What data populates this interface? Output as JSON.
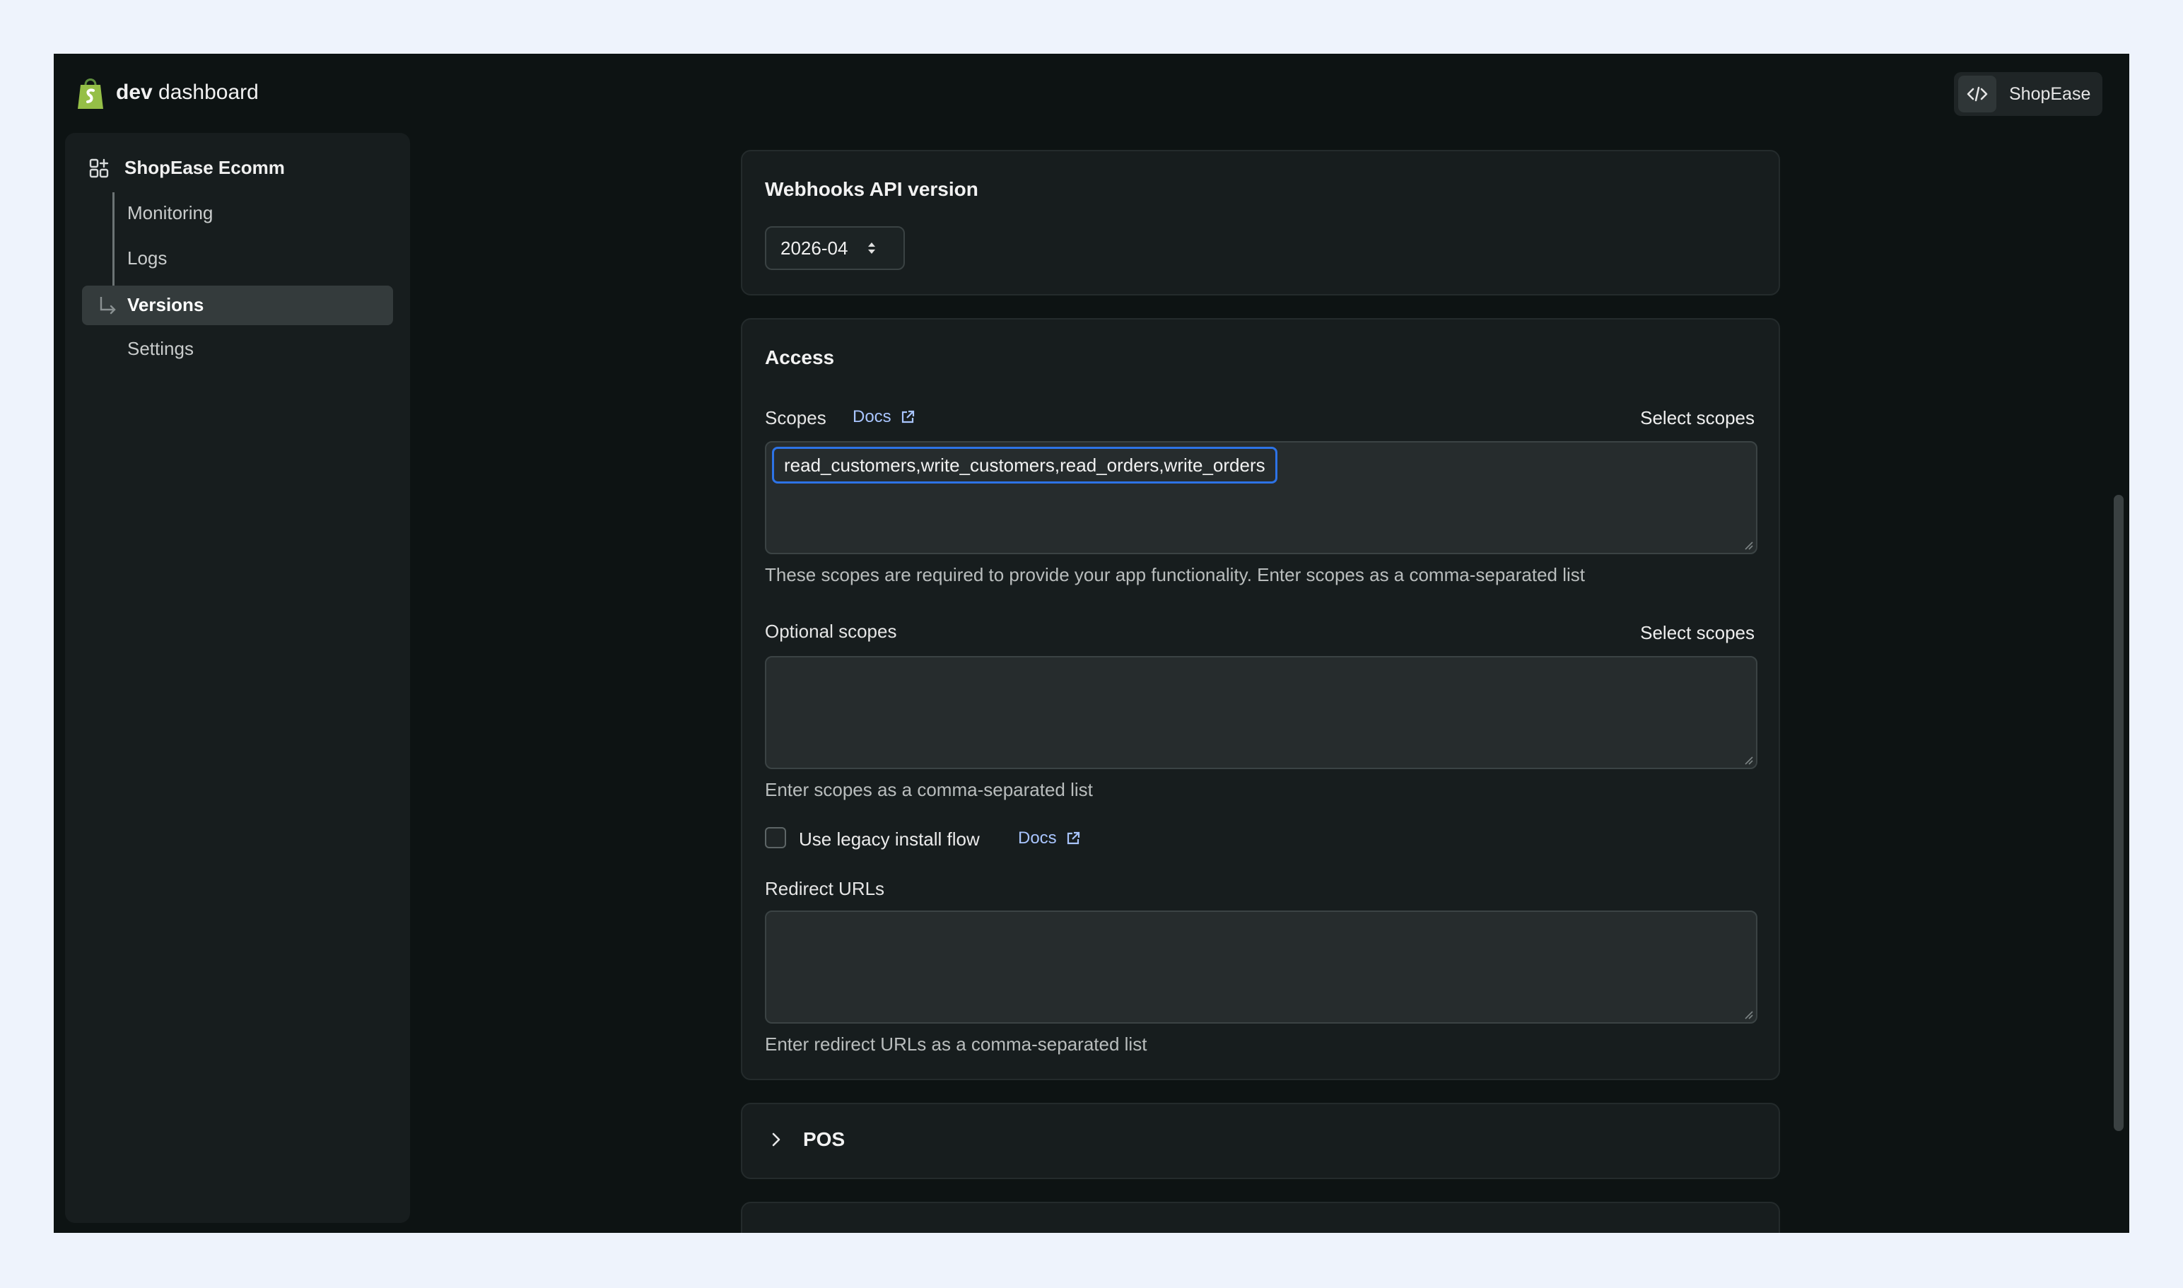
{
  "header": {
    "logo_bold": "dev",
    "logo_rest": "dashboard",
    "app_name": "ShopEase"
  },
  "sidebar": {
    "app_title": "ShopEase Ecomm",
    "items": [
      {
        "label": "Monitoring",
        "active": false
      },
      {
        "label": "Logs",
        "active": false
      },
      {
        "label": "Versions",
        "active": true
      },
      {
        "label": "Settings",
        "active": false
      }
    ]
  },
  "webhooks": {
    "title": "Webhooks API version",
    "selected_version": "2026-04"
  },
  "access": {
    "title": "Access",
    "scopes_label": "Scopes",
    "docs_label": "Docs",
    "select_scopes_label": "Select scopes",
    "scopes_value": "read_customers,write_customers,read_orders,write_orders",
    "scopes_help": "These scopes are required to provide your app functionality. Enter scopes as a comma-separated list",
    "optional_scopes_label": "Optional scopes",
    "optional_select_scopes_label": "Select scopes",
    "optional_scopes_value": "",
    "optional_scopes_help": "Enter scopes as a comma-separated list",
    "legacy_install_label": "Use legacy install flow",
    "legacy_install_checked": false,
    "legacy_docs_label": "Docs",
    "redirect_urls_label": "Redirect URLs",
    "redirect_urls_value": "",
    "redirect_urls_help": "Enter redirect URLs as a comma-separated list"
  },
  "pos": {
    "title": "POS"
  },
  "colors": {
    "brand_green": "#95bf47",
    "link_blue": "#a9c5ff",
    "focus_blue": "#2d73e6",
    "background": "#0d1313",
    "card": "#171d1e"
  },
  "icons": {
    "logo": "shopify-bag-icon",
    "dev": "code-icon",
    "app": "apps-icon",
    "external": "external-link-icon",
    "chevron": "chevron-right-icon",
    "select": "up-down-arrows-icon"
  }
}
